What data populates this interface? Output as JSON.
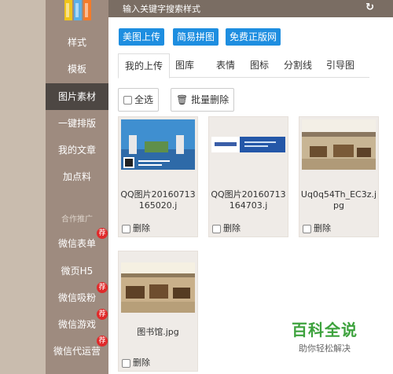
{
  "sidebar": {
    "items": [
      {
        "label": "样式"
      },
      {
        "label": "模板"
      },
      {
        "label": "图片素材"
      },
      {
        "label": "一键排版"
      },
      {
        "label": "我的文章"
      },
      {
        "label": "加点料"
      }
    ],
    "section_title": "合作推广",
    "promo_items": [
      {
        "label": "微信表单",
        "badge": "荐"
      },
      {
        "label": "微页H5",
        "badge": ""
      },
      {
        "label": "微信吸粉",
        "badge": "荐"
      },
      {
        "label": "微信游戏",
        "badge": "荐"
      },
      {
        "label": "微信代运营",
        "badge": "荐"
      }
    ]
  },
  "topbar": {
    "search_placeholder": "输入关键字搜索样式"
  },
  "toolbar": {
    "buttons": [
      "美图上传",
      "简易拼图",
      "免费正版网"
    ]
  },
  "tabs": [
    "我的上传",
    "图库",
    "表情",
    "图标",
    "分割线",
    "引导图"
  ],
  "actions": {
    "select_all": "全选",
    "batch_delete": "批量删除"
  },
  "images": [
    {
      "name": "QQ图片20160713165020.j",
      "delete_label": "删除"
    },
    {
      "name": "QQ图片20160713164703.j",
      "delete_label": "删除"
    },
    {
      "name": "Uq0q54Th_EC3z.jpg",
      "delete_label": "删除"
    },
    {
      "name": "图书馆.jpg",
      "delete_label": "删除"
    }
  ],
  "watermark": {
    "main": "百科全说",
    "sub": "助你轻松解决"
  },
  "colors": {
    "accent": "#1e8ee0",
    "sidebar_active": "#4d4743",
    "badge": "#e02a2a",
    "topbar": "#7a6d63"
  }
}
